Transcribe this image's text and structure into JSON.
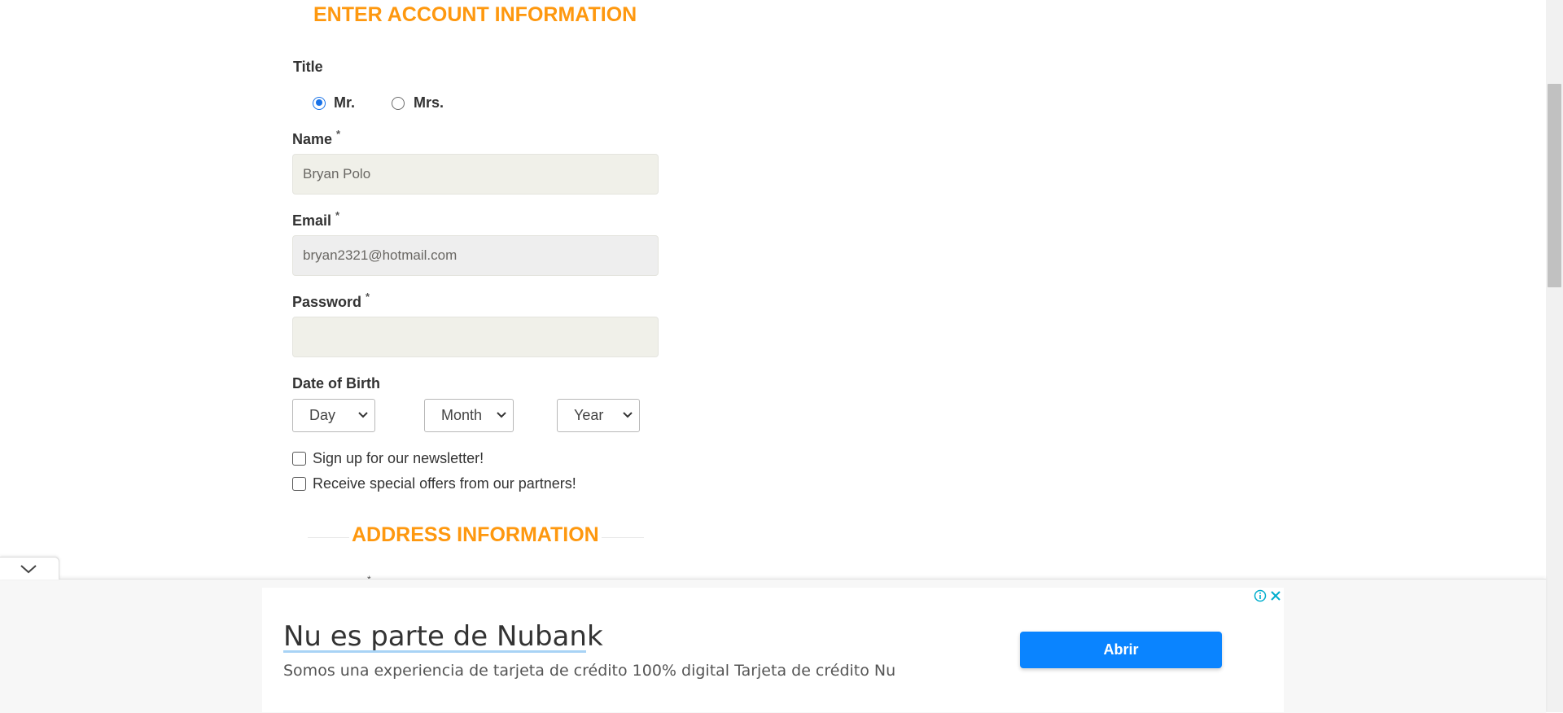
{
  "account_section": {
    "title": "ENTER ACCOUNT INFORMATION",
    "title_label": "Title",
    "title_options": [
      {
        "label": "Mr.",
        "checked": true
      },
      {
        "label": "Mrs.",
        "checked": false
      }
    ],
    "name": {
      "label": "Name",
      "required": "*",
      "value": "Bryan Polo"
    },
    "email": {
      "label": "Email",
      "required": "*",
      "value": "bryan2321@hotmail.com"
    },
    "password": {
      "label": "Password",
      "required": "*",
      "value": ""
    },
    "dob": {
      "label": "Date of Birth",
      "day": "Day",
      "month": "Month",
      "year": "Year"
    },
    "newsletter_label": "Sign up for our newsletter!",
    "offers_label": "Receive special offers from our partners!"
  },
  "address_section": {
    "title": "ADDRESS INFORMATION"
  },
  "ad": {
    "title": "Nu es parte de Nubank",
    "description": "Somos una experiencia de tarjeta de crédito 100% digital Tarjeta de crédito Nu",
    "button_label": "Abrir",
    "accent_color": "#0a84ff"
  },
  "colors": {
    "section_title": "#fe980f",
    "field_bg": "#f0f0e9"
  }
}
